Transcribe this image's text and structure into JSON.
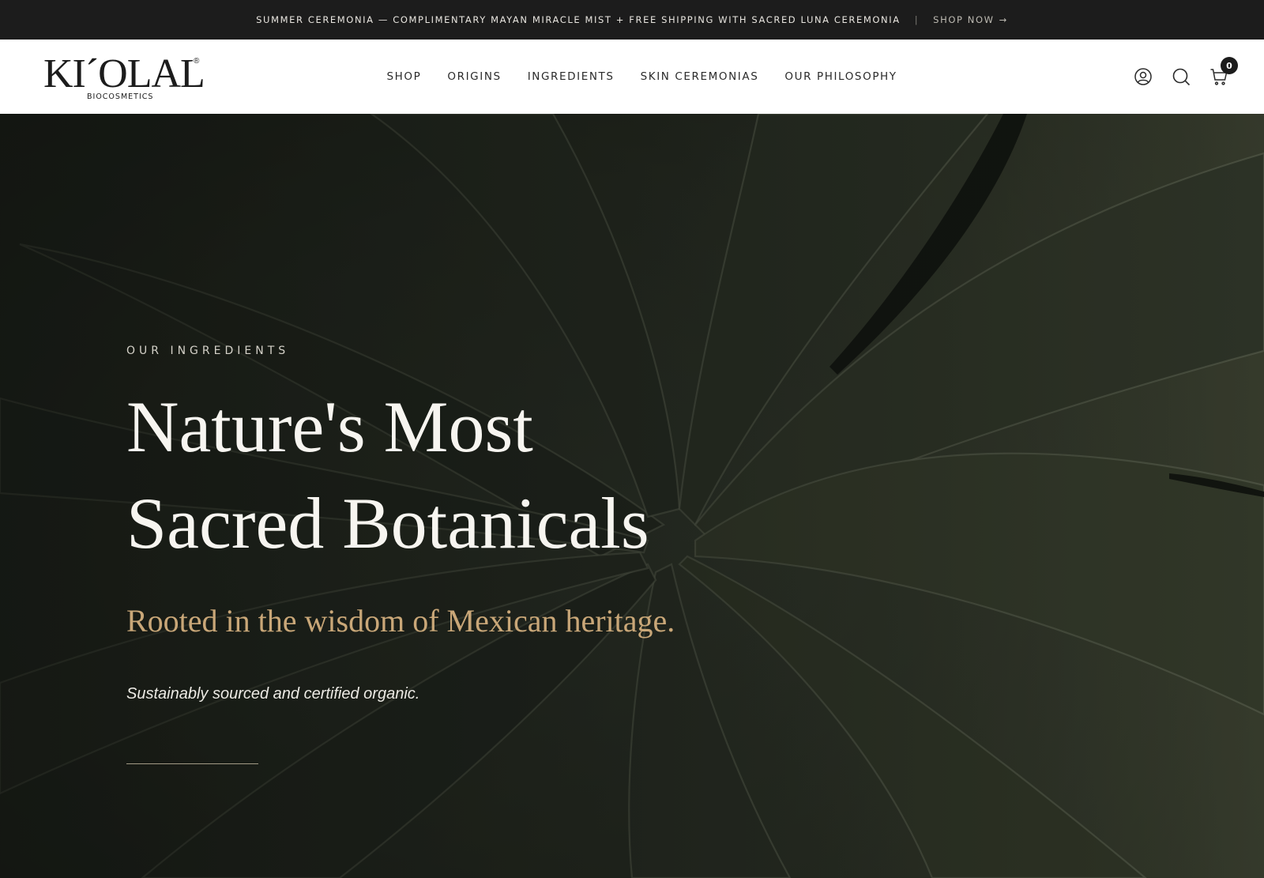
{
  "announcement": {
    "text": "SUMMER CEREMONIA — COMPLIMENTARY MAYAN MIRACLE MIST + FREE SHIPPING WITH SACRED LUNA CEREMONIA",
    "separator": "|",
    "link_label": "SHOP NOW",
    "link_arrow": "→"
  },
  "header": {
    "logo": {
      "wordmark": "KI´OLAL",
      "registered": "®",
      "subtitle": "BIOCOSMETICS"
    },
    "nav": [
      {
        "label": "SHOP"
      },
      {
        "label": "ORIGINS"
      },
      {
        "label": "INGREDIENTS"
      },
      {
        "label": "SKIN CEREMONIAS"
      },
      {
        "label": "OUR PHILOSOPHY"
      }
    ],
    "icons": [
      "account-icon",
      "search-icon",
      "cart-icon"
    ],
    "cart_count": "0"
  },
  "hero": {
    "eyebrow": "OUR INGREDIENTS",
    "headline_line1": "Nature's Most",
    "headline_line2": "Sacred Botanicals",
    "subheadline": "Rooted in the wisdom of Mexican heritage.",
    "tagline": "Sustainably sourced and certified organic."
  },
  "colors": {
    "announcement_bg": "#1c1c1c",
    "header_bg": "#ffffff",
    "accent_gold": "#c9a778",
    "hero_text": "#f7f5f0"
  }
}
